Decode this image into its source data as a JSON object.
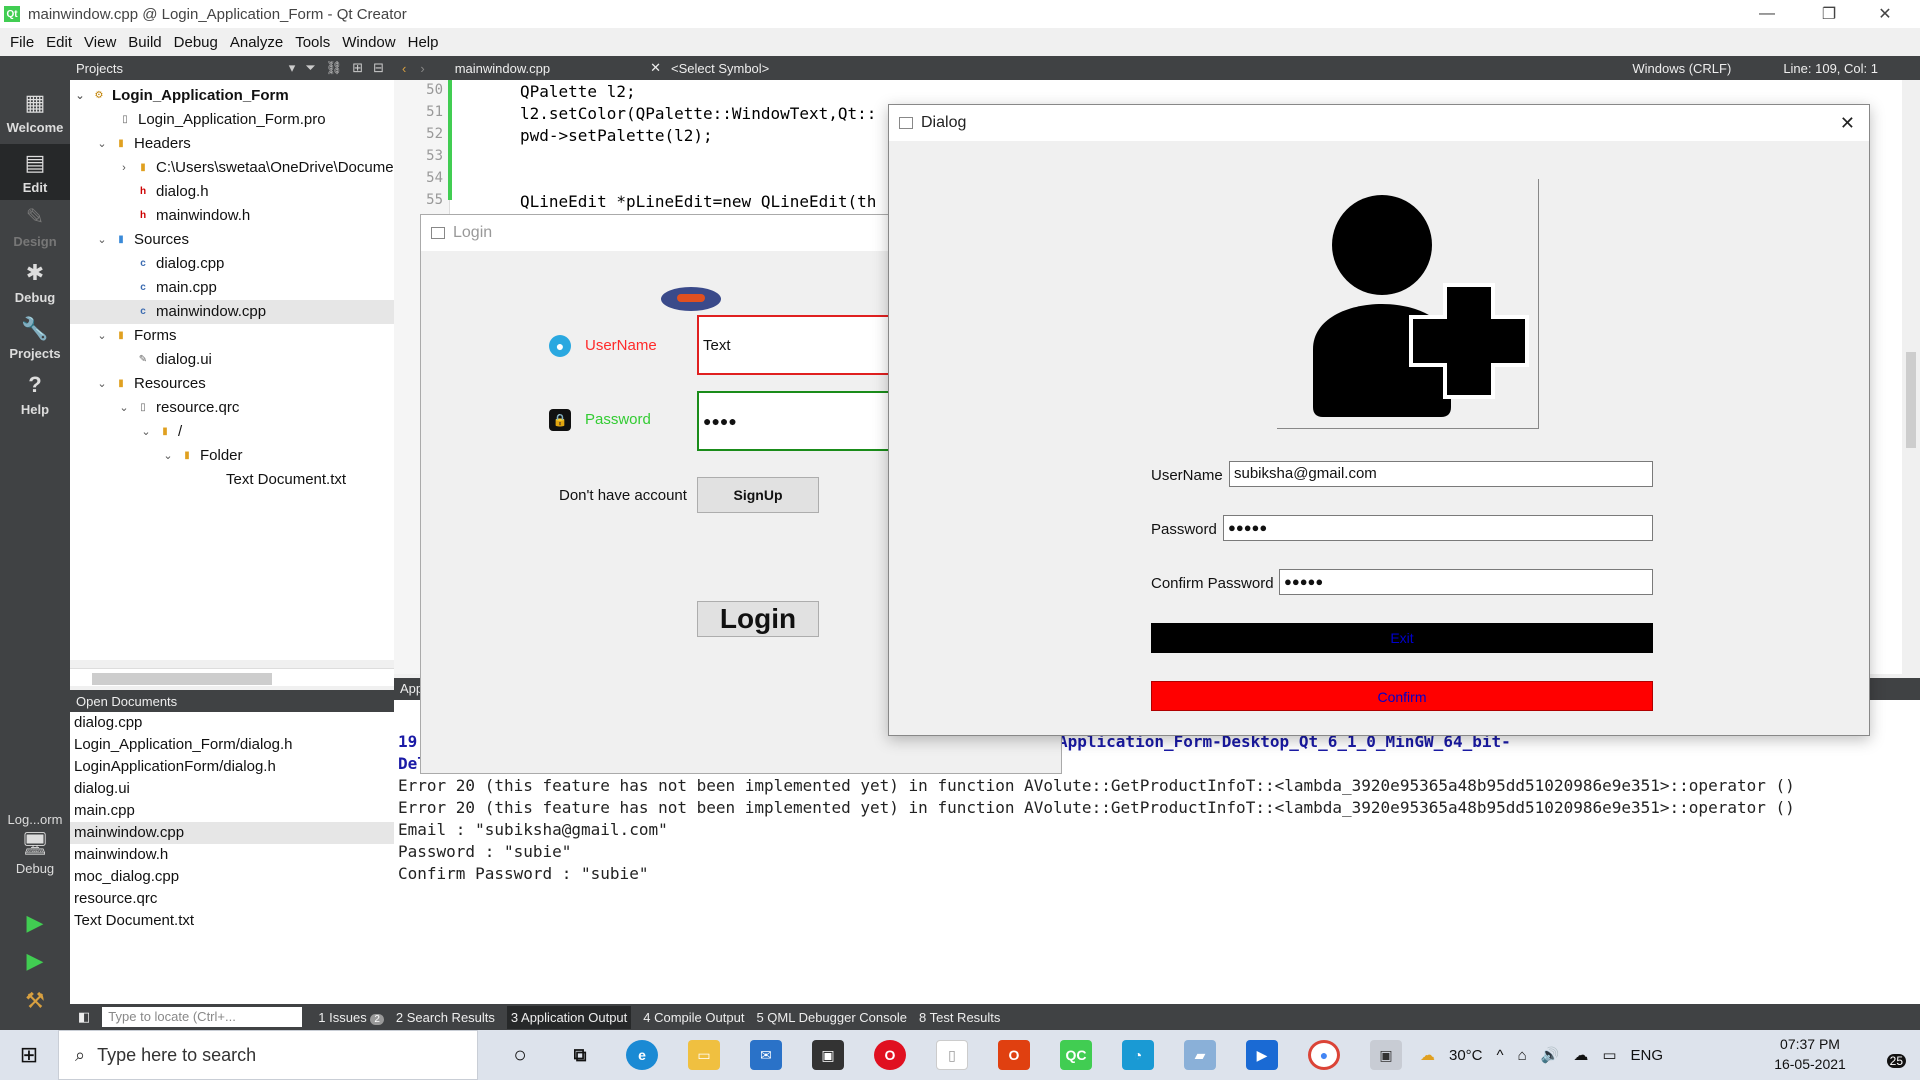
{
  "window": {
    "title": "mainwindow.cpp @ Login_Application_Form - Qt Creator"
  },
  "menu": [
    "File",
    "Edit",
    "View",
    "Build",
    "Debug",
    "Analyze",
    "Tools",
    "Window",
    "Help"
  ],
  "modes": [
    {
      "label": "Welcome",
      "icon": "grid-icon"
    },
    {
      "label": "Edit",
      "icon": "edit-icon"
    },
    {
      "label": "Design",
      "icon": "pencil-icon"
    },
    {
      "label": "Debug",
      "icon": "bug-icon"
    },
    {
      "label": "Projects",
      "icon": "wrench-icon"
    },
    {
      "label": "Help",
      "icon": "help-icon"
    }
  ],
  "target": {
    "label": "Log...orm",
    "mode": "Debug"
  },
  "projects_panel": {
    "title": "Projects"
  },
  "tree": [
    {
      "label": "Login_Application_Form",
      "bold": true
    },
    {
      "label": "Login_Application_Form.pro"
    },
    {
      "label": "Headers"
    },
    {
      "label": "C:\\Users\\swetaa\\OneDrive\\Docume"
    },
    {
      "label": "dialog.h"
    },
    {
      "label": "mainwindow.h"
    },
    {
      "label": "Sources"
    },
    {
      "label": "dialog.cpp"
    },
    {
      "label": "main.cpp"
    },
    {
      "label": "mainwindow.cpp"
    },
    {
      "label": "Forms"
    },
    {
      "label": "dialog.ui"
    },
    {
      "label": "Resources"
    },
    {
      "label": "resource.qrc"
    },
    {
      "label": "/"
    },
    {
      "label": "Folder"
    },
    {
      "label": "Text Document.txt"
    }
  ],
  "open_docs": {
    "title": "Open Documents",
    "items": [
      "dialog.cpp",
      "Login_Application_Form/dialog.h",
      "LoginApplicationForm/dialog.h",
      "dialog.ui",
      "main.cpp",
      "mainwindow.cpp",
      "mainwindow.h",
      "moc_dialog.cpp",
      "resource.qrc",
      "Text Document.txt"
    ]
  },
  "editor_toolbar": {
    "file": "mainwindow.cpp",
    "symbol": "<Select Symbol>",
    "line_endings": "Windows (CRLF)",
    "position": "Line: 109, Col: 1"
  },
  "code": [
    {
      "n": "50",
      "text": "QPalette l2;"
    },
    {
      "n": "51",
      "text": "l2.setColor(QPalette::WindowText,Qt::"
    },
    {
      "n": "52",
      "text": "pwd->setPalette(l2);"
    },
    {
      "n": "53",
      "text": ""
    },
    {
      "n": "54",
      "text": ""
    },
    {
      "n": "55",
      "text": "QLineEdit *pLineEdit=new QLineEdit(th"
    }
  ],
  "output_head": "App",
  "output_lines": [
    {
      "text": "19",
      "blue": true
    },
    {
      "text": "Application_Form-Desktop_Qt_6_1_0_MinGW_64_bit-",
      "blue": true
    },
    {
      "text": "Del",
      "blue": true
    },
    {
      "text": "Error 20 (this feature has not been implemented yet) in function AVolute::GetProductInfoT::<lambda_3920e95365a48b95dd51020986e9e351>::operator ()"
    },
    {
      "text": "Error 20 (this feature has not been implemented yet) in function AVolute::GetProductInfoT::<lambda_3920e95365a48b95dd51020986e9e351>::operator ()"
    },
    {
      "text": "Email : \"subiksha@gmail.com\""
    },
    {
      "text": "Password : \"subie\""
    },
    {
      "text": "Confirm Password : \"subie\""
    }
  ],
  "status": {
    "locate_placeholder": "Type to locate (Ctrl+...",
    "panes": [
      "1 Issues",
      "2 Search Results",
      "3 Application Output",
      "4 Compile Output",
      "5 QML Debugger Console",
      "8 Test Results"
    ],
    "issues_count": "2"
  },
  "login": {
    "title": "Login",
    "username_label": "UserName",
    "username_value": "Text",
    "password_label": "Password",
    "password_value": "●●●●",
    "no_account": "Don't have account",
    "signup": "SignUp",
    "login": "Login",
    "colors": {
      "username": "#ff2a2a",
      "password": "#33cc33",
      "username_border": "#e02020",
      "password_border": "#1a8c1a"
    }
  },
  "dialog": {
    "title": "Dialog",
    "username_label": "UserName",
    "username_value": "subiksha@gmail.com",
    "password_label": "Password",
    "password_value": "●●●●●",
    "confirm_label": "Confirm Password",
    "confirm_value": "●●●●●",
    "exit": "Exit",
    "confirm": "Confirm",
    "colors": {
      "exit_bg": "#000000",
      "exit_text": "#0000cc",
      "confirm_bg": "#ff0000",
      "confirm_text": "#0000cc"
    }
  },
  "taskbar": {
    "search_placeholder": "Type here to search",
    "weather": "30°C",
    "lang": "ENG",
    "time": "07:37 PM",
    "date": "16-05-2021",
    "notifications": "25"
  }
}
